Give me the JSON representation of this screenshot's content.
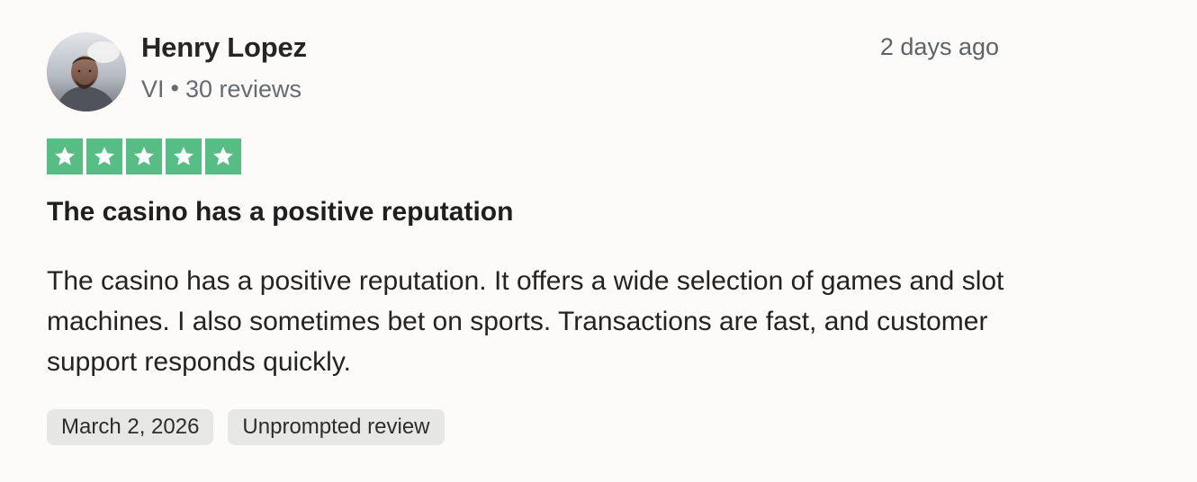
{
  "review": {
    "reviewer": {
      "name": "Henry Lopez",
      "country_code": "VI",
      "meta_separator": "•",
      "review_count": "30 reviews"
    },
    "relative_date": "2 days ago",
    "rating": {
      "value": 5,
      "max": 5,
      "color": "#58bd84",
      "icon": "star-icon"
    },
    "title": "The casino has a positive reputation",
    "body": "The casino has a positive reputation. It offers a wide selection of games and slot machines. I also sometimes bet on sports. Transactions are fast, and customer support responds quickly.",
    "tags": [
      "March 2, 2026",
      "Unprompted review"
    ]
  },
  "colors": {
    "page_background": "#fcfbf9",
    "tag_background": "#e7e7e6",
    "meta_text": "#666b70"
  },
  "icons": {
    "avatar": "avatar-icon",
    "star": "star-icon"
  }
}
